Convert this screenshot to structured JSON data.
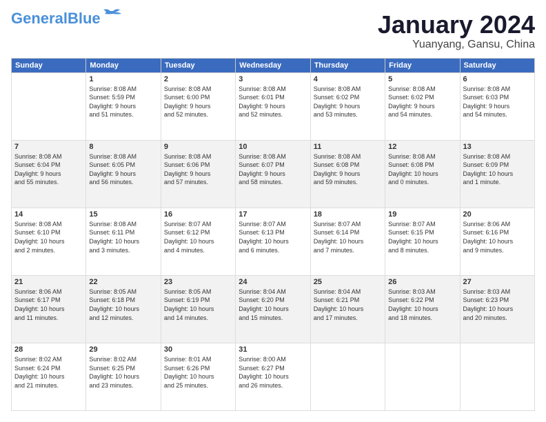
{
  "logo": {
    "line1": "General",
    "line2": "Blue"
  },
  "title": "January 2024",
  "subtitle": "Yuanyang, Gansu, China",
  "weekdays": [
    "Sunday",
    "Monday",
    "Tuesday",
    "Wednesday",
    "Thursday",
    "Friday",
    "Saturday"
  ],
  "weeks": [
    [
      {
        "day": "",
        "info": ""
      },
      {
        "day": "1",
        "info": "Sunrise: 8:08 AM\nSunset: 5:59 PM\nDaylight: 9 hours\nand 51 minutes."
      },
      {
        "day": "2",
        "info": "Sunrise: 8:08 AM\nSunset: 6:00 PM\nDaylight: 9 hours\nand 52 minutes."
      },
      {
        "day": "3",
        "info": "Sunrise: 8:08 AM\nSunset: 6:01 PM\nDaylight: 9 hours\nand 52 minutes."
      },
      {
        "day": "4",
        "info": "Sunrise: 8:08 AM\nSunset: 6:02 PM\nDaylight: 9 hours\nand 53 minutes."
      },
      {
        "day": "5",
        "info": "Sunrise: 8:08 AM\nSunset: 6:02 PM\nDaylight: 9 hours\nand 54 minutes."
      },
      {
        "day": "6",
        "info": "Sunrise: 8:08 AM\nSunset: 6:03 PM\nDaylight: 9 hours\nand 54 minutes."
      }
    ],
    [
      {
        "day": "7",
        "info": "Sunrise: 8:08 AM\nSunset: 6:04 PM\nDaylight: 9 hours\nand 55 minutes."
      },
      {
        "day": "8",
        "info": "Sunrise: 8:08 AM\nSunset: 6:05 PM\nDaylight: 9 hours\nand 56 minutes."
      },
      {
        "day": "9",
        "info": "Sunrise: 8:08 AM\nSunset: 6:06 PM\nDaylight: 9 hours\nand 57 minutes."
      },
      {
        "day": "10",
        "info": "Sunrise: 8:08 AM\nSunset: 6:07 PM\nDaylight: 9 hours\nand 58 minutes."
      },
      {
        "day": "11",
        "info": "Sunrise: 8:08 AM\nSunset: 6:08 PM\nDaylight: 9 hours\nand 59 minutes."
      },
      {
        "day": "12",
        "info": "Sunrise: 8:08 AM\nSunset: 6:08 PM\nDaylight: 10 hours\nand 0 minutes."
      },
      {
        "day": "13",
        "info": "Sunrise: 8:08 AM\nSunset: 6:09 PM\nDaylight: 10 hours\nand 1 minute."
      }
    ],
    [
      {
        "day": "14",
        "info": "Sunrise: 8:08 AM\nSunset: 6:10 PM\nDaylight: 10 hours\nand 2 minutes."
      },
      {
        "day": "15",
        "info": "Sunrise: 8:08 AM\nSunset: 6:11 PM\nDaylight: 10 hours\nand 3 minutes."
      },
      {
        "day": "16",
        "info": "Sunrise: 8:07 AM\nSunset: 6:12 PM\nDaylight: 10 hours\nand 4 minutes."
      },
      {
        "day": "17",
        "info": "Sunrise: 8:07 AM\nSunset: 6:13 PM\nDaylight: 10 hours\nand 6 minutes."
      },
      {
        "day": "18",
        "info": "Sunrise: 8:07 AM\nSunset: 6:14 PM\nDaylight: 10 hours\nand 7 minutes."
      },
      {
        "day": "19",
        "info": "Sunrise: 8:07 AM\nSunset: 6:15 PM\nDaylight: 10 hours\nand 8 minutes."
      },
      {
        "day": "20",
        "info": "Sunrise: 8:06 AM\nSunset: 6:16 PM\nDaylight: 10 hours\nand 9 minutes."
      }
    ],
    [
      {
        "day": "21",
        "info": "Sunrise: 8:06 AM\nSunset: 6:17 PM\nDaylight: 10 hours\nand 11 minutes."
      },
      {
        "day": "22",
        "info": "Sunrise: 8:05 AM\nSunset: 6:18 PM\nDaylight: 10 hours\nand 12 minutes."
      },
      {
        "day": "23",
        "info": "Sunrise: 8:05 AM\nSunset: 6:19 PM\nDaylight: 10 hours\nand 14 minutes."
      },
      {
        "day": "24",
        "info": "Sunrise: 8:04 AM\nSunset: 6:20 PM\nDaylight: 10 hours\nand 15 minutes."
      },
      {
        "day": "25",
        "info": "Sunrise: 8:04 AM\nSunset: 6:21 PM\nDaylight: 10 hours\nand 17 minutes."
      },
      {
        "day": "26",
        "info": "Sunrise: 8:03 AM\nSunset: 6:22 PM\nDaylight: 10 hours\nand 18 minutes."
      },
      {
        "day": "27",
        "info": "Sunrise: 8:03 AM\nSunset: 6:23 PM\nDaylight: 10 hours\nand 20 minutes."
      }
    ],
    [
      {
        "day": "28",
        "info": "Sunrise: 8:02 AM\nSunset: 6:24 PM\nDaylight: 10 hours\nand 21 minutes."
      },
      {
        "day": "29",
        "info": "Sunrise: 8:02 AM\nSunset: 6:25 PM\nDaylight: 10 hours\nand 23 minutes."
      },
      {
        "day": "30",
        "info": "Sunrise: 8:01 AM\nSunset: 6:26 PM\nDaylight: 10 hours\nand 25 minutes."
      },
      {
        "day": "31",
        "info": "Sunrise: 8:00 AM\nSunset: 6:27 PM\nDaylight: 10 hours\nand 26 minutes."
      },
      {
        "day": "",
        "info": ""
      },
      {
        "day": "",
        "info": ""
      },
      {
        "day": "",
        "info": ""
      }
    ]
  ]
}
